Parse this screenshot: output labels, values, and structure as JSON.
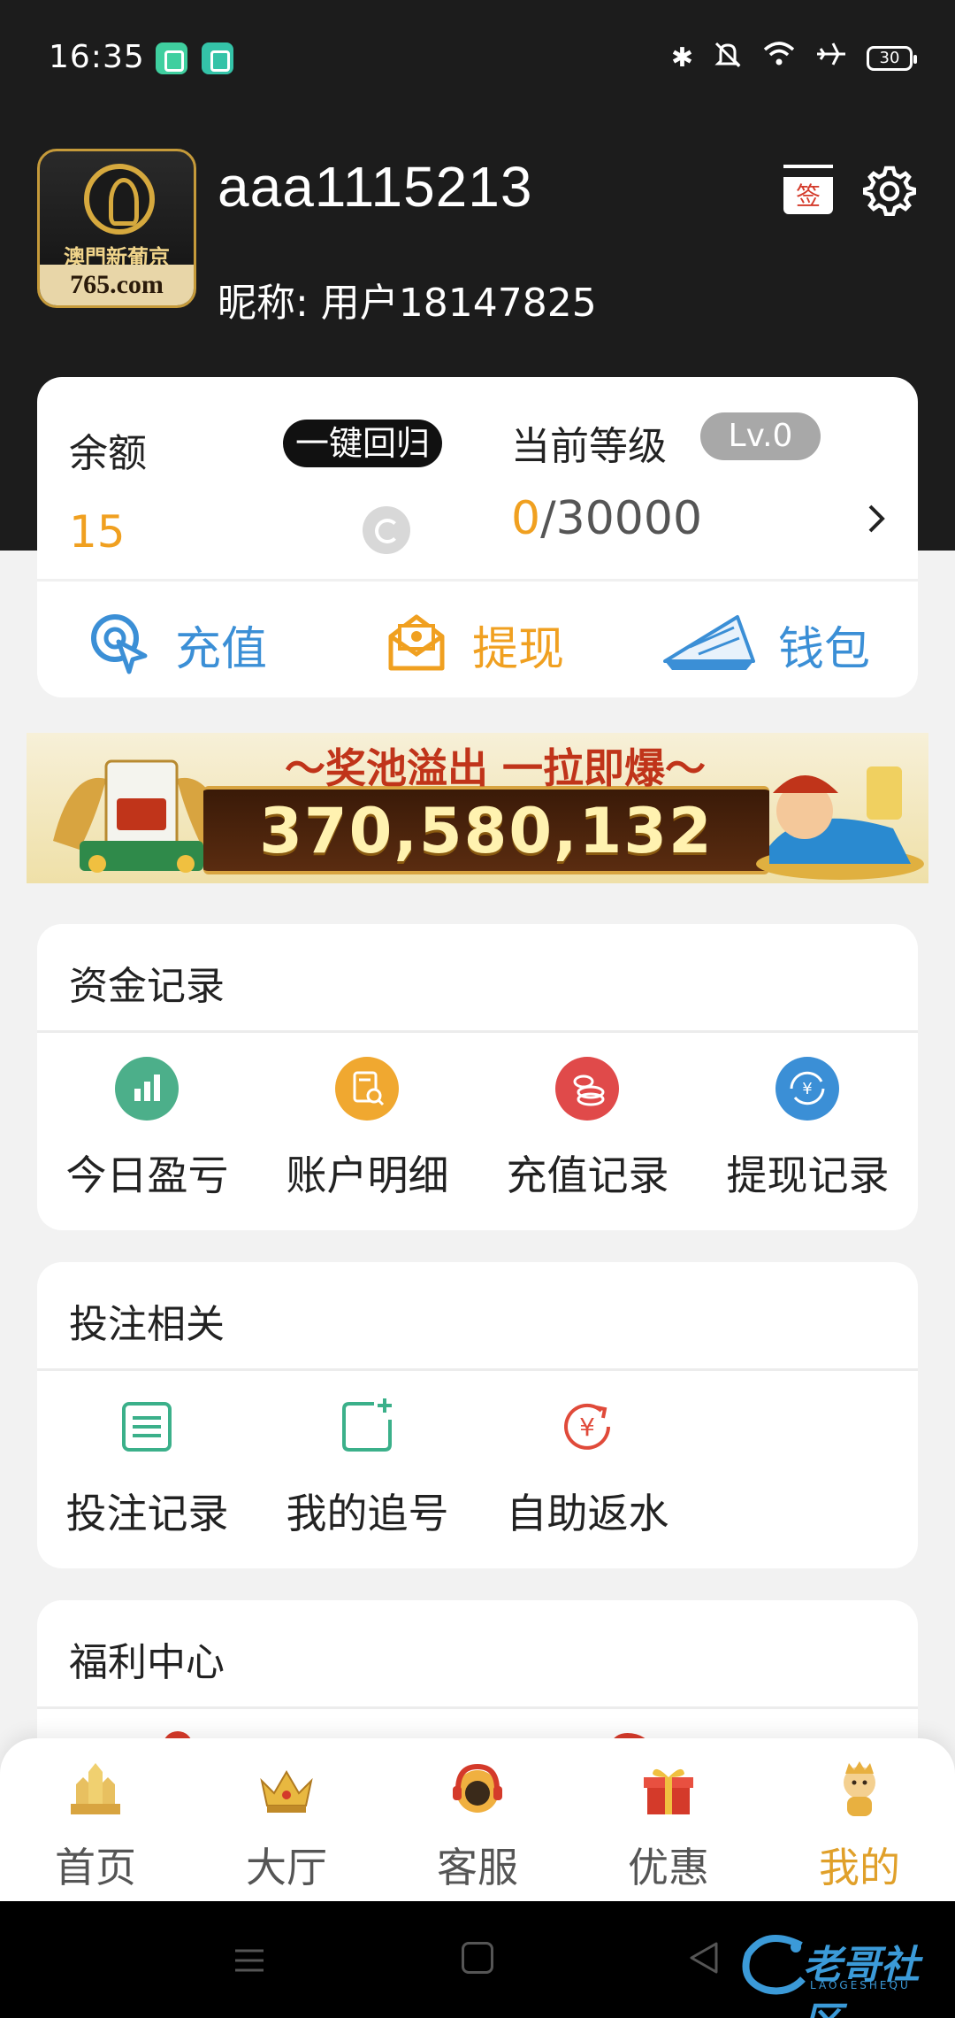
{
  "status_bar": {
    "time": "16:35",
    "battery": "30"
  },
  "profile": {
    "logo_cn": "澳門新葡京",
    "logo_url": "765.com",
    "username": "aaa1115213",
    "nickname": "昵称: 用户18147825",
    "sign_label": "签"
  },
  "balance": {
    "label": "余额",
    "return_button": "一键回归",
    "value": "15",
    "level_label": "当前等级",
    "level_badge": "Lv.0",
    "level_current": "0",
    "level_target": "/30000"
  },
  "quick_actions": [
    {
      "label": "充值",
      "icon": "recharge-icon"
    },
    {
      "label": "提现",
      "icon": "withdraw-icon"
    },
    {
      "label": "钱包",
      "icon": "wallet-icon"
    }
  ],
  "jackpot": {
    "title": "～奖池溢出 一拉即爆～",
    "amount": "370,580,132"
  },
  "sections": {
    "funds": {
      "title": "资金记录",
      "items": [
        {
          "label": "今日盈亏",
          "color": "#4caf8a",
          "icon": "bar-chart-icon"
        },
        {
          "label": "账户明细",
          "color": "#f0a830",
          "icon": "document-search-icon"
        },
        {
          "label": "充值记录",
          "color": "#e04a4a",
          "icon": "coins-icon"
        },
        {
          "label": "提现记录",
          "color": "#3b8fd6",
          "icon": "yen-exchange-icon"
        }
      ]
    },
    "bets": {
      "title": "投注相关",
      "items": [
        {
          "label": "投注记录",
          "color": "#3bb08a",
          "icon": "list-icon"
        },
        {
          "label": "我的追号",
          "color": "#3bb08a",
          "icon": "add-square-icon"
        },
        {
          "label": "自助返水",
          "color": "#e04a3a",
          "icon": "yen-refresh-icon"
        }
      ]
    },
    "welfare": {
      "title": "福利中心"
    }
  },
  "bottom_nav": [
    {
      "label": "首页",
      "icon": "home-castle-icon",
      "active": false
    },
    {
      "label": "大厅",
      "icon": "crown-icon",
      "active": false
    },
    {
      "label": "客服",
      "icon": "headset-icon",
      "active": false
    },
    {
      "label": "优惠",
      "icon": "gift-icon",
      "active": false
    },
    {
      "label": "我的",
      "icon": "mascot-icon",
      "active": true
    }
  ],
  "watermark": {
    "text": "老哥社区",
    "sub": "LAOGESHEQU"
  }
}
